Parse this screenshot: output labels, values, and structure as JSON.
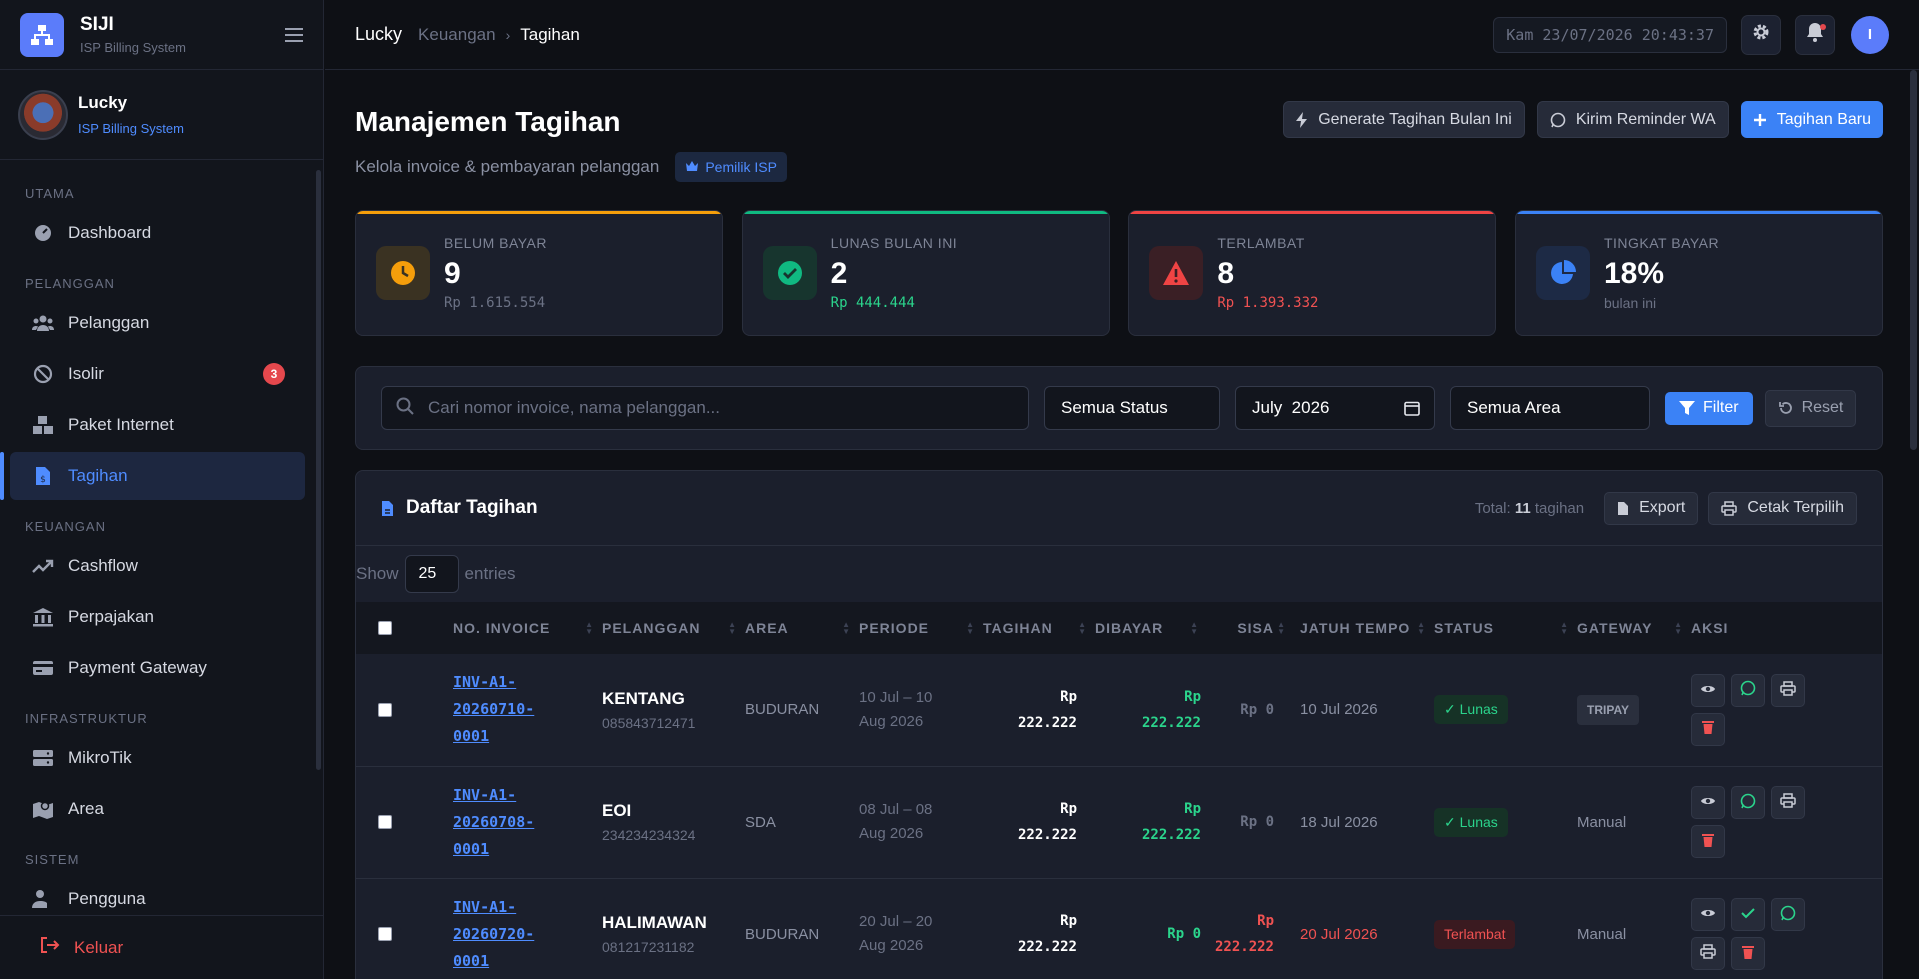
{
  "app": {
    "name": "SIJI",
    "subtitle": "ISP Billing System"
  },
  "user": {
    "name": "Lucky",
    "role": "ISP Billing System",
    "initial": "I"
  },
  "sidebar": {
    "sections": [
      {
        "label": "UTAMA",
        "items": [
          {
            "label": "Dashboard",
            "icon": "gauge-icon"
          }
        ]
      },
      {
        "label": "PELANGGAN",
        "items": [
          {
            "label": "Pelanggan",
            "icon": "users-icon"
          },
          {
            "label": "Isolir",
            "icon": "ban-icon",
            "badge": "3"
          },
          {
            "label": "Paket Internet",
            "icon": "boxes-icon"
          },
          {
            "label": "Tagihan",
            "icon": "invoice-icon",
            "active": true
          }
        ]
      },
      {
        "label": "KEUANGAN",
        "items": [
          {
            "label": "Cashflow",
            "icon": "trend-icon"
          },
          {
            "label": "Perpajakan",
            "icon": "bank-icon"
          },
          {
            "label": "Payment Gateway",
            "icon": "card-icon"
          }
        ]
      },
      {
        "label": "INFRASTRUKTUR",
        "items": [
          {
            "label": "MikroTik",
            "icon": "server-icon"
          },
          {
            "label": "Area",
            "icon": "map-icon"
          }
        ]
      },
      {
        "label": "SISTEM",
        "items": [
          {
            "label": "Pengguna",
            "icon": "user-gear-icon"
          }
        ]
      }
    ],
    "logout": "Keluar"
  },
  "topbar": {
    "breadcrumb": [
      "Lucky",
      "Keuangan",
      "Tagihan"
    ],
    "clock": "Kam 23/07/2026 20:43:37"
  },
  "page": {
    "title": "Manajemen Tagihan",
    "subtitle": "Kelola invoice & pembayaran pelanggan",
    "role_badge": "Pemilik ISP",
    "actions": {
      "generate": "Generate Tagihan Bulan Ini",
      "reminder": "Kirim Reminder WA",
      "new": "Tagihan Baru"
    }
  },
  "stats": [
    {
      "label": "BELUM BAYAR",
      "value": "9",
      "sub": "Rp 1.615.554",
      "color": "#f59e0b"
    },
    {
      "label": "LUNAS BULAN INI",
      "value": "2",
      "sub": "Rp 444.444",
      "color": "#10b981"
    },
    {
      "label": "TERLAMBAT",
      "value": "8",
      "sub": "Rp 1.393.332",
      "color": "#ef4444"
    },
    {
      "label": "TINGKAT BAYAR",
      "value": "18%",
      "sub": "bulan ini",
      "color": "#3b82f6"
    }
  ],
  "filters": {
    "search_placeholder": "Cari nomor invoice, nama pelanggan...",
    "status": "Semua Status",
    "month": "July  2026",
    "area": "Semua Area",
    "filter": "Filter",
    "reset": "Reset"
  },
  "table": {
    "title": "Daftar Tagihan",
    "total_prefix": "Total: ",
    "total_count": "11",
    "total_suffix": " tagihan",
    "export": "Export",
    "print_selected": "Cetak Terpilih",
    "show": "Show",
    "length": "25",
    "entries": "entries",
    "columns": [
      "NO. INVOICE",
      "PELANGGAN",
      "AREA",
      "PERIODE",
      "TAGIHAN",
      "DIBAYAR",
      "SISA",
      "JATUH TEMPO",
      "STATUS",
      "GATEWAY",
      "AKSI"
    ],
    "rows": [
      {
        "invoice": [
          "INV-A1-",
          "20260710-",
          "0001"
        ],
        "name": "KENTANG",
        "phone": "085843712471",
        "area": "BUDURAN",
        "period": [
          "10 Jul – 10",
          "Aug 2026"
        ],
        "tagihan": [
          "Rp",
          "222.222"
        ],
        "dibayar": [
          "Rp",
          "222.222"
        ],
        "sisa": "Rp 0",
        "due": "10 Jul 2026",
        "status": "✓ Lunas",
        "gateway": "TRIPAY"
      },
      {
        "invoice": [
          "INV-A1-",
          "20260708-",
          "0001"
        ],
        "name": "EOI",
        "phone": "234234234324",
        "area": "SDA",
        "period": [
          "08 Jul – 08",
          "Aug 2026"
        ],
        "tagihan": [
          "Rp",
          "222.222"
        ],
        "dibayar": [
          "Rp",
          "222.222"
        ],
        "sisa": "Rp 0",
        "due": "18 Jul 2026",
        "status": "✓ Lunas",
        "gateway": "Manual"
      },
      {
        "invoice": [
          "INV-A1-",
          "20260720-",
          "0001"
        ],
        "name": "HALIMAWAN",
        "phone": "081217231182",
        "area": "BUDURAN",
        "period": [
          "20 Jul – 20",
          "Aug 2026"
        ],
        "tagihan": [
          "Rp",
          "222.222"
        ],
        "dibayar": "Rp 0",
        "sisa": [
          "Rp",
          "222.222"
        ],
        "due": "20 Jul 2026",
        "status": "Terlambat",
        "gateway": "Manual"
      }
    ]
  }
}
